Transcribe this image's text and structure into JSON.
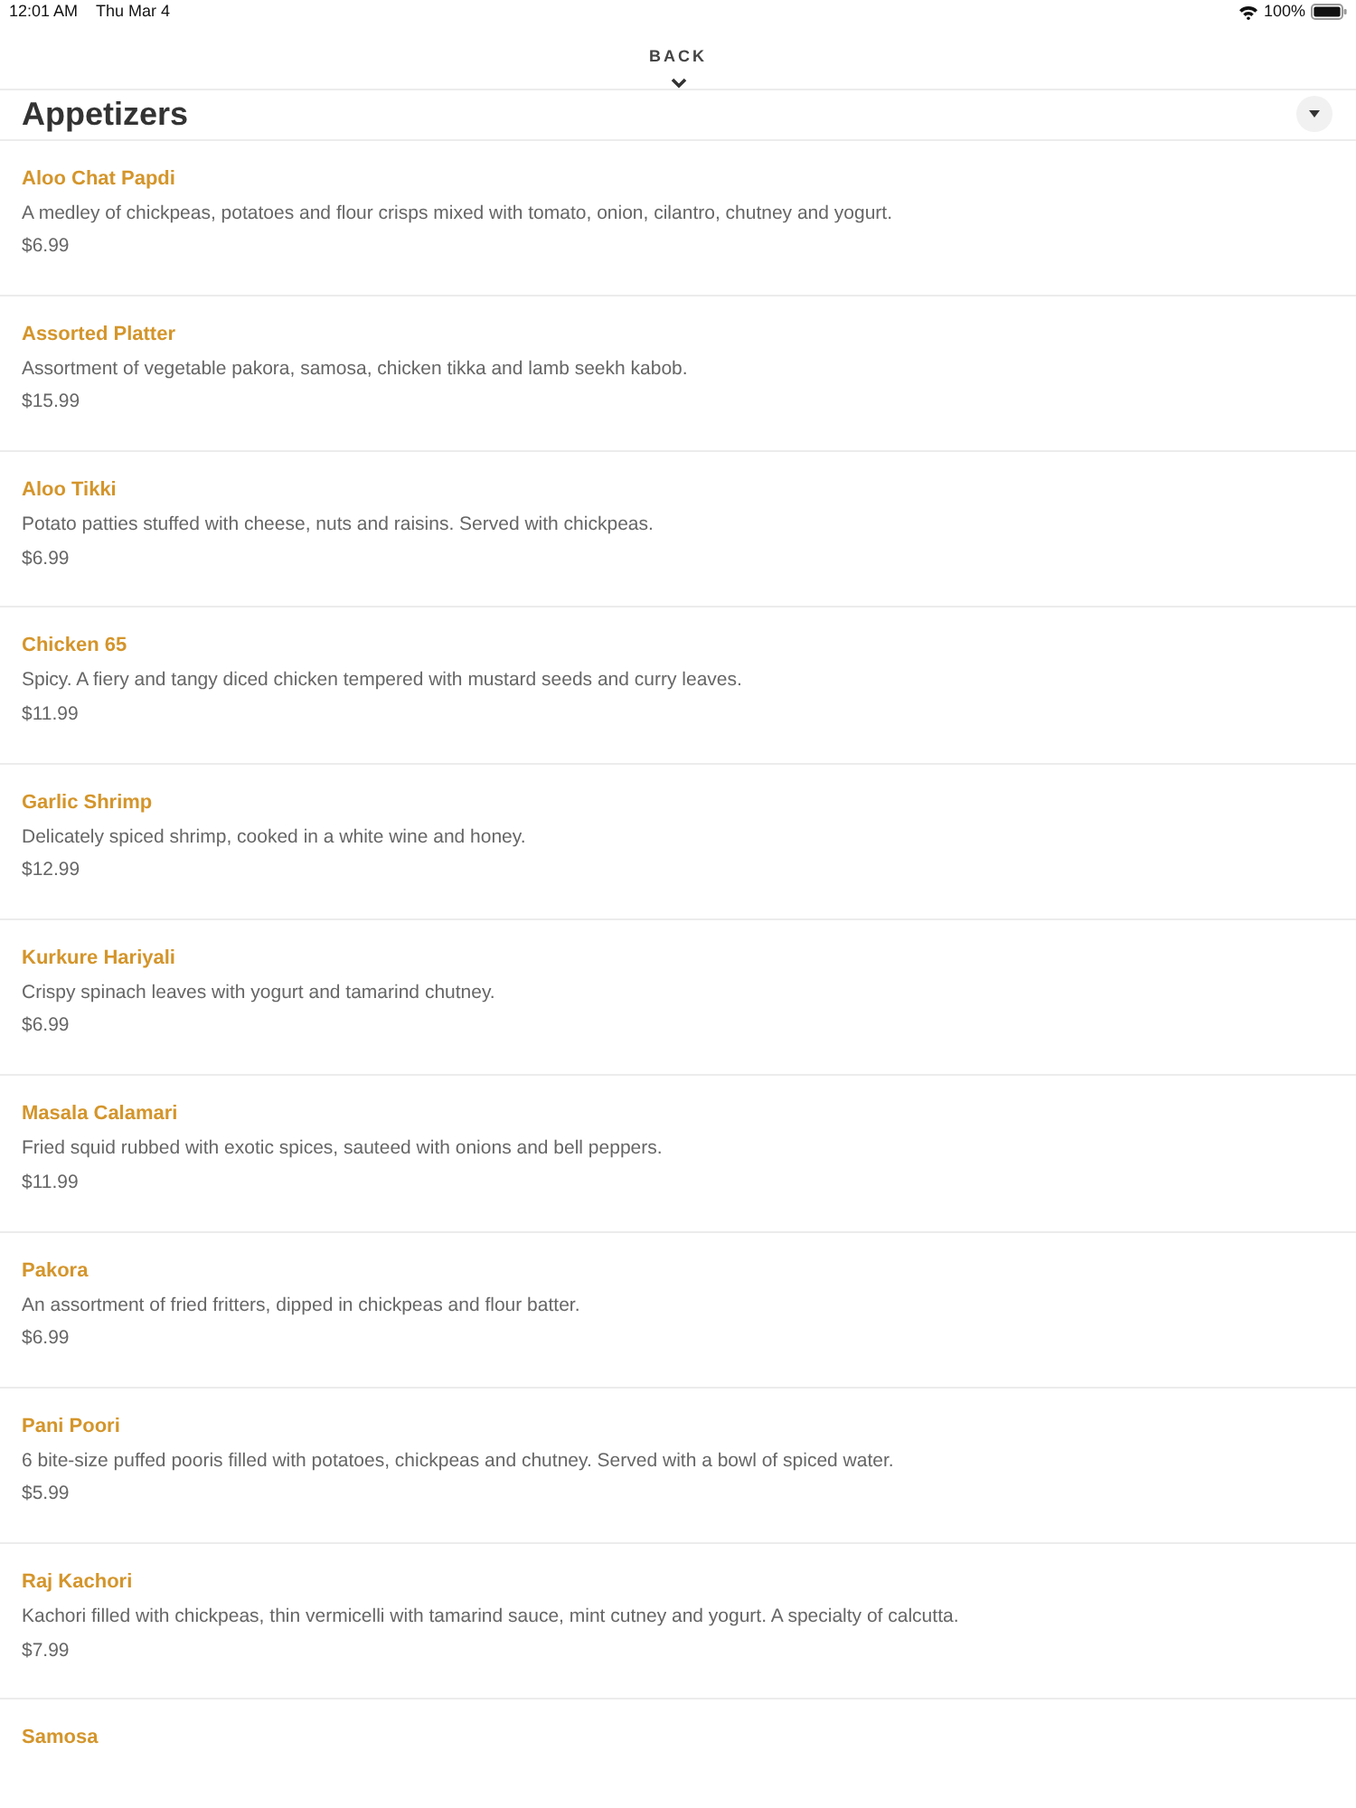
{
  "status_bar": {
    "time": "12:01 AM",
    "date": "Thu Mar 4",
    "battery": "100%"
  },
  "back_button": {
    "label": "BACK"
  },
  "section": {
    "title": "Appetizers"
  },
  "items": [
    {
      "name": "Aloo Chat Papdi",
      "description": "A medley of chickpeas, potatoes and flour crisps mixed with tomato, onion, cilantro, chutney and yogurt.",
      "price": "$6.99"
    },
    {
      "name": "Assorted Platter",
      "description": "Assortment of vegetable pakora, samosa, chicken tikka and lamb seekh kabob.",
      "price": "$15.99"
    },
    {
      "name": "Aloo Tikki",
      "description": "Potato patties stuffed with cheese, nuts and raisins. Served with chickpeas.",
      "price": "$6.99"
    },
    {
      "name": "Chicken 65",
      "description": "Spicy. A fiery and tangy diced chicken tempered with mustard seeds and curry leaves.",
      "price": "$11.99"
    },
    {
      "name": "Garlic Shrimp",
      "description": "Delicately spiced shrimp, cooked in a white wine and honey.",
      "price": "$12.99"
    },
    {
      "name": "Kurkure Hariyali",
      "description": "Crispy spinach leaves with yogurt and tamarind chutney.",
      "price": "$6.99"
    },
    {
      "name": "Masala Calamari",
      "description": "Fried squid rubbed with exotic spices, sauteed with onions and bell peppers.",
      "price": "$11.99"
    },
    {
      "name": "Pakora",
      "description": "An assortment of fried fritters, dipped in chickpeas and flour batter.",
      "price": "$6.99"
    },
    {
      "name": "Pani Poori",
      "description": "6 bite-size puffed pooris filled with potatoes, chickpeas and chutney. Served with a bowl of spiced water.",
      "price": "$5.99"
    },
    {
      "name": "Raj Kachori",
      "description": "Kachori filled with chickpeas, thin vermicelli with tamarind sauce, mint cutney and yogurt. A specialty of calcutta.",
      "price": "$7.99"
    },
    {
      "name": "Samosa"
    }
  ]
}
